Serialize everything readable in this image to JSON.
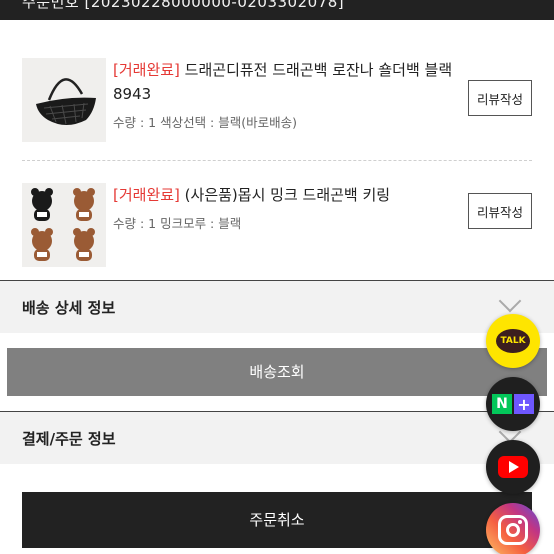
{
  "header": {
    "order_number_text": "주문번호 [20230228000000-0203302078]"
  },
  "items": [
    {
      "status": "[거래완료]",
      "name": " 드래곤디퓨전 드래곤백 로잔나 숄더백 블랙 8943",
      "options": "수량 : 1 색상선택 : 블랙(바로배송)",
      "review_label": "리뷰작성",
      "image_icon": "black-woven-shoulder-bag"
    },
    {
      "status": "[거래완료]",
      "name": " (사은품)몹시 밍크 드래곤백 키링",
      "options": "수량 : 1 밍크모루 : 블랙",
      "review_label": "리뷰작성",
      "image_icon": "mink-bear-keyring"
    }
  ],
  "shipping": {
    "title": "배송 상세 정보",
    "track_label": "배송조회"
  },
  "payment": {
    "title": "결제/주문 정보",
    "cancel_label": "주문취소"
  },
  "floating": {
    "talk_label": "TALK",
    "naver_n": "N",
    "naver_plus": "+",
    "icons": [
      "kakaotalk-icon",
      "naver-plus-icon",
      "youtube-icon",
      "instagram-icon"
    ]
  },
  "colors": {
    "status_red": "#e53935",
    "dark": "#222222",
    "track_gray": "#808080",
    "kakao_yellow": "#fee500"
  }
}
